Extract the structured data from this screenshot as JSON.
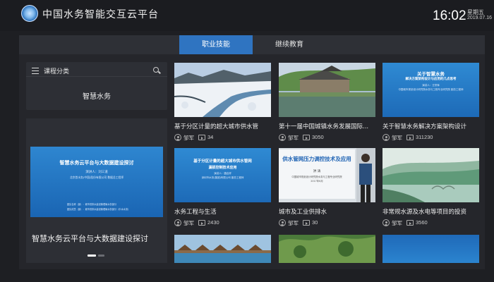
{
  "header": {
    "app_title": "中国水务智能交互云平台",
    "time": "16:02",
    "weekday": "星期五",
    "date": "2019.07.16"
  },
  "tabs": [
    {
      "label": "职业技能",
      "active": true
    },
    {
      "label": "继续教育",
      "active": false
    }
  ],
  "sidebar": {
    "title": "课程分类",
    "category": "智慧水务",
    "featured": {
      "slide_title": "智慧水务云平台与大数据建设探讨",
      "slide_presenter": "演讲人：刘三道",
      "slide_org": "北京首水务(中国)股份有限公司 数据总工程师",
      "slide_note1": "团队名称（部）：城市供排水建设管理局水务部分",
      "slide_note2": "团队成员（部）：城市供排水建设管理局水务部分（中水水务）",
      "caption": "智慧水务云平台与大数据建设探讨",
      "active_dot": 0,
      "dot_count": 2
    }
  },
  "cards": [
    {
      "title": "基于分区计量的超大城市供水管",
      "author": "邹军",
      "views": "34",
      "thumb": "snow-river-photo"
    },
    {
      "title": "第十一届中国城镇水务发展国际...",
      "author": "邹军",
      "views": "3050",
      "thumb": "village-lake-photo"
    },
    {
      "title": "关于智慧水务解决方案架构设计",
      "author": "邹军",
      "views": "311230",
      "thumb": "slide",
      "slide_title": "关于智慧水务",
      "slide_sub": "解决方案架构设计与应用的几点思考",
      "slide_presenter": "演讲人：汪宗辉",
      "slide_org": "中国城市规划设计研究院水务与工程专业研究院 副总工程师"
    },
    {
      "title": "水务工程与生活",
      "author": "邹军",
      "views": "2430",
      "thumb": "slide",
      "slide_title": "基于分区计量的超大城市供水管网",
      "slide_sub": "漏损控制技术应用",
      "slide_presenter": "演讲人：唐启祥",
      "slide_org": "深圳市水务(集团)有限公司 副总工程师"
    },
    {
      "title": "城市及工业供排水",
      "author": "邹军",
      "views": "30",
      "thumb": "lecture-photo",
      "slide_title": "供水管网压力调控技术及应用",
      "slide_presenter": "洪 涛",
      "slide_org": "中国城市规划设计研究院水务与工程专业研究院",
      "slide_year": "2017年6月"
    },
    {
      "title": "非常规水源及水电等项目的投资",
      "author": "邹军",
      "views": "3560",
      "thumb": "misty-lake-photo"
    },
    {
      "title": "",
      "author": "",
      "views": "",
      "thumb": "resort-photo"
    },
    {
      "title": "",
      "author": "",
      "views": "",
      "thumb": "forest-photo"
    },
    {
      "title": "",
      "author": "",
      "views": "",
      "thumb": "blue-slide"
    }
  ],
  "colors": {
    "accent": "#2f74c1",
    "background": "#1e1f23",
    "panel": "#25262b"
  }
}
